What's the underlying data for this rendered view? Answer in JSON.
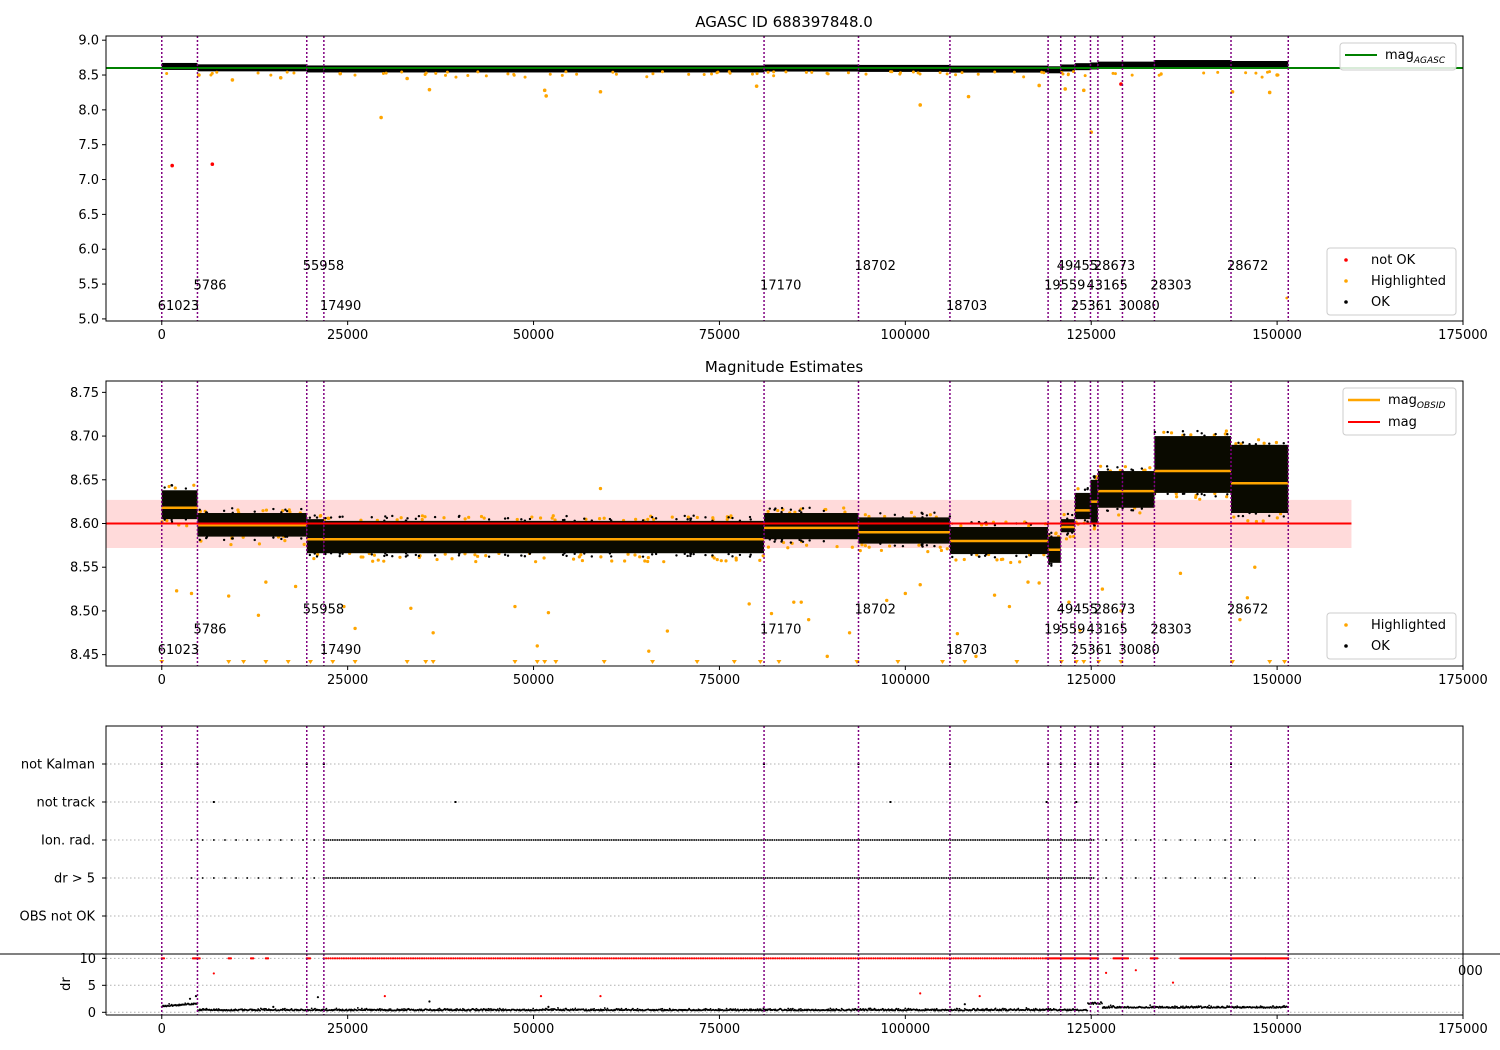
{
  "chart_data": [
    {
      "type": "scatter",
      "title": "AGASC ID 688397848.0",
      "xlim": [
        -7500,
        175000
      ],
      "ylim": [
        4.97,
        9.06
      ],
      "x_ticks": [
        0,
        25000,
        50000,
        75000,
        100000,
        125000,
        150000,
        175000
      ],
      "x_tick_labels": [
        "0",
        "25000",
        "50000",
        "75000",
        "100000",
        "125000",
        "150000",
        "175000"
      ],
      "y_ticks": [
        5.0,
        5.5,
        6.0,
        6.5,
        7.0,
        7.5,
        8.0,
        8.5,
        9.0
      ],
      "y_tick_labels": [
        "5.0",
        "5.5",
        "6.0",
        "6.5",
        "7.0",
        "7.5",
        "8.0",
        "8.5",
        "9.0"
      ],
      "mag_agasc": 8.6,
      "legend_top": {
        "placement": "top-right",
        "entries": [
          {
            "label": "mag",
            "sub": "AGASC",
            "color": "#008000"
          }
        ]
      },
      "legend_bottom": {
        "placement": "bottom-right",
        "entries": [
          {
            "label": "not OK",
            "color": "#ff0000"
          },
          {
            "label": "Highlighted",
            "color": "#ffa500"
          },
          {
            "label": "OK",
            "color": "#000000"
          }
        ]
      },
      "obsid_label_rows": [
        5.7,
        5.42,
        5.13
      ],
      "series": [
        {
          "name": "not OK",
          "color": "#ff0000",
          "points": [
            [
              1400,
              7.2
            ],
            [
              6800,
              7.22
            ],
            [
              129000,
              8.37
            ]
          ]
        },
        {
          "name": "Highlighted",
          "color": "#ffa500",
          "points": [
            [
              5000,
              8.5
            ],
            [
              9500,
              8.43
            ],
            [
              16000,
              8.46
            ],
            [
              24000,
              8.52
            ],
            [
              29500,
              7.89
            ],
            [
              33000,
              8.45
            ],
            [
              36000,
              8.29
            ],
            [
              51500,
              8.28
            ],
            [
              51700,
              8.2
            ],
            [
              59000,
              8.26
            ],
            [
              80000,
              8.34
            ],
            [
              102000,
              8.07
            ],
            [
              108500,
              8.19
            ],
            [
              118000,
              8.35
            ],
            [
              121500,
              8.3
            ],
            [
              124000,
              8.28
            ],
            [
              125000,
              7.68
            ],
            [
              144000,
              8.26
            ],
            [
              149000,
              8.25
            ],
            [
              150000,
              8.5
            ]
          ]
        }
      ]
    },
    {
      "type": "scatter",
      "title": "Magnitude Estimates",
      "xlim": [
        -7500,
        175000
      ],
      "ylim": [
        8.437,
        8.763
      ],
      "x_ticks": [
        0,
        25000,
        50000,
        75000,
        100000,
        125000,
        150000,
        175000
      ],
      "x_tick_labels": [
        "0",
        "25000",
        "50000",
        "75000",
        "100000",
        "125000",
        "150000",
        "175000"
      ],
      "y_ticks": [
        8.45,
        8.5,
        8.55,
        8.6,
        8.65,
        8.7,
        8.75
      ],
      "y_tick_labels": [
        "8.45",
        "8.50",
        "8.55",
        "8.60",
        "8.65",
        "8.70",
        "8.75"
      ],
      "mag": 8.6,
      "mag_band": [
        8.572,
        8.627
      ],
      "mag_line_xrange": [
        -7500,
        160000
      ],
      "legend_top": {
        "placement": "top-right",
        "entries": [
          {
            "label": "mag",
            "sub": "OBSID",
            "color": "#ffa500"
          },
          {
            "label": "mag",
            "color": "#ff0000"
          }
        ]
      },
      "legend_bottom": {
        "placement": "bottom-right",
        "entries": [
          {
            "label": "Highlighted",
            "color": "#ffa500"
          },
          {
            "label": "OK",
            "color": "#000000"
          }
        ]
      },
      "obsid_label_rows": [
        8.497,
        8.474,
        8.451
      ],
      "obsid_segments": [
        {
          "x0": 0,
          "x1": 4800,
          "mean": 8.618,
          "lo": 8.605,
          "hi": 8.638
        },
        {
          "x0": 4800,
          "x1": 19500,
          "mean": 8.598,
          "lo": 8.585,
          "hi": 8.612
        },
        {
          "x0": 19500,
          "x1": 21800,
          "mean": 8.582,
          "lo": 8.566,
          "hi": 8.605
        },
        {
          "x0": 21800,
          "x1": 81000,
          "mean": 8.582,
          "lo": 8.566,
          "hi": 8.603
        },
        {
          "x0": 81000,
          "x1": 93700,
          "mean": 8.595,
          "lo": 8.582,
          "hi": 8.612
        },
        {
          "x0": 93700,
          "x1": 106000,
          "mean": 8.59,
          "lo": 8.577,
          "hi": 8.607
        },
        {
          "x0": 106000,
          "x1": 119200,
          "mean": 8.58,
          "lo": 8.565,
          "hi": 8.596
        },
        {
          "x0": 119200,
          "x1": 120900,
          "mean": 8.57,
          "lo": 8.555,
          "hi": 8.585
        },
        {
          "x0": 120900,
          "x1": 122800,
          "mean": 8.596,
          "lo": 8.59,
          "hi": 8.605
        },
        {
          "x0": 122800,
          "x1": 124900,
          "mean": 8.615,
          "lo": 8.605,
          "hi": 8.635
        },
        {
          "x0": 124900,
          "x1": 125900,
          "mean": 8.625,
          "lo": 8.6,
          "hi": 8.65
        },
        {
          "x0": 125900,
          "x1": 129200,
          "mean": 8.637,
          "lo": 8.618,
          "hi": 8.66
        },
        {
          "x0": 129200,
          "x1": 133500,
          "mean": 8.637,
          "lo": 8.618,
          "hi": 8.66
        },
        {
          "x0": 133500,
          "x1": 143800,
          "mean": 8.66,
          "lo": 8.635,
          "hi": 8.7
        },
        {
          "x0": 143800,
          "x1": 151500,
          "mean": 8.646,
          "lo": 8.612,
          "hi": 8.69
        }
      ],
      "series": [
        {
          "name": "Highlighted",
          "color": "#ffa500",
          "points": [
            [
              2000,
              8.523
            ],
            [
              4000,
              8.52
            ],
            [
              9000,
              8.517
            ],
            [
              13000,
              8.495
            ],
            [
              14000,
              8.533
            ],
            [
              18000,
              8.528
            ],
            [
              24500,
              8.505
            ],
            [
              26000,
              8.48
            ],
            [
              33500,
              8.503
            ],
            [
              36500,
              8.475
            ],
            [
              47500,
              8.505
            ],
            [
              50500,
              8.46
            ],
            [
              52000,
              8.498
            ],
            [
              59000,
              8.64
            ],
            [
              65500,
              8.454
            ],
            [
              68000,
              8.477
            ],
            [
              79000,
              8.508
            ],
            [
              82000,
              8.497
            ],
            [
              85000,
              8.51
            ],
            [
              86000,
              8.51
            ],
            [
              87000,
              8.49
            ],
            [
              89500,
              8.448
            ],
            [
              92500,
              8.475
            ],
            [
              97500,
              8.512
            ],
            [
              100000,
              8.52
            ],
            [
              102000,
              8.53
            ],
            [
              107000,
              8.474
            ],
            [
              109500,
              8.448
            ],
            [
              112000,
              8.518
            ],
            [
              114000,
              8.505
            ],
            [
              116500,
              8.533
            ],
            [
              118000,
              8.532
            ],
            [
              122000,
              8.51
            ],
            [
              123500,
              8.478
            ],
            [
              126500,
              8.525
            ],
            [
              129000,
              8.5
            ],
            [
              137000,
              8.543
            ],
            [
              146000,
              8.515
            ],
            [
              147000,
              8.55
            ],
            [
              145000,
              8.49
            ]
          ]
        }
      ],
      "clipped_low_markers": [
        0,
        9000,
        11000,
        14000,
        17000,
        20000,
        23000,
        26000,
        33000,
        35500,
        36500,
        47500,
        50500,
        51500,
        53000,
        59500,
        66000,
        72000,
        77000,
        80500,
        83000,
        93500,
        99000,
        105000,
        108000,
        115000,
        121000,
        123000,
        124000,
        126000,
        129000,
        144000,
        149000,
        151000
      ]
    },
    {
      "type": "scatter",
      "title": "",
      "xlim": [
        -7500,
        175000
      ],
      "category_labels": [
        "not Kalman",
        "not track",
        "Ion. rad.",
        "dr > 5",
        "OBS not OK"
      ],
      "flags": {
        "not Kalman": [
          0,
          4800,
          19500,
          21800,
          81000,
          93700,
          106000,
          119200,
          120900,
          122800,
          124900,
          125900,
          129200,
          133500,
          143800
        ],
        "not track": [
          7000,
          39500,
          98000,
          119000,
          123000
        ],
        "Ion. rad.": [
          [
            4000,
            21000,
            1500
          ],
          [
            21800,
            125500,
            300
          ],
          [
            127000,
            148500,
            2000
          ]
        ],
        "dr > 5": [
          [
            4000,
            21000,
            1500
          ],
          [
            21800,
            125500,
            300
          ],
          [
            127000,
            148500,
            2000
          ]
        ],
        "OBS not OK": []
      },
      "dr_panel": {
        "ylabel": "dr",
        "ylim": [
          -0.5,
          10.8
        ],
        "y_ticks": [
          0,
          5,
          10
        ],
        "y_tick_labels": [
          "0",
          "5",
          "10"
        ],
        "x_ticks": [
          0,
          25000,
          50000,
          75000,
          100000,
          125000,
          150000,
          175000
        ],
        "x_tick_labels": [
          "0",
          "25000",
          "50000",
          "75000",
          "100000",
          "125000",
          "150000",
          "175000"
        ],
        "overlap_tick_label": "000",
        "red_outliers": [
          [
            7000,
            7.2
          ],
          [
            30000,
            3.0
          ],
          [
            51000,
            3.0
          ],
          [
            59000,
            3.0
          ],
          [
            102000,
            3.5
          ],
          [
            110000,
            3.0
          ],
          [
            127000,
            7.3
          ],
          [
            131000,
            7.8
          ],
          [
            136000,
            5.5
          ]
        ],
        "dr_clip": 10
      }
    }
  ],
  "obsids": [
    {
      "label": "61023",
      "x": 0,
      "row": 2
    },
    {
      "label": "5786",
      "x": 4800,
      "row": 1
    },
    {
      "label": "55958",
      "x": 19500,
      "row": 0
    },
    {
      "label": "17490",
      "x": 21800,
      "row": 2
    },
    {
      "label": "17170",
      "x": 81000,
      "row": 1
    },
    {
      "label": "18702",
      "x": 93700,
      "row": 0
    },
    {
      "label": "18703",
      "x": 106000,
      "row": 2
    },
    {
      "label": "19559",
      "x": 119200,
      "row": 1
    },
    {
      "label": "49455",
      "x": 120900,
      "row": 0
    },
    {
      "label": "25361",
      "x": 122800,
      "row": 2
    },
    {
      "label": "43165",
      "x": 124900,
      "row": 1
    },
    {
      "label": "28673",
      "x": 125900,
      "row": 0
    },
    {
      "label": "30080",
      "x": 129200,
      "row": 2
    },
    {
      "label": "28303",
      "x": 133500,
      "row": 1
    },
    {
      "label": "28672",
      "x": 143800,
      "row": 0
    }
  ],
  "obsid_boundaries": [
    0,
    4800,
    19500,
    21800,
    81000,
    93700,
    106000,
    119200,
    120900,
    122800,
    124900,
    125900,
    129200,
    133500,
    143800,
    151500
  ],
  "data_extent": [
    0,
    151500
  ],
  "colors": {
    "obsid_line": "#800080",
    "ok": "#000000",
    "highlighted": "#ffa500",
    "not_ok": "#ff0000",
    "mag_agasc": "#008000",
    "mag": "#ff0000",
    "band": "#ffdada",
    "grid": "#b0b0b0"
  }
}
